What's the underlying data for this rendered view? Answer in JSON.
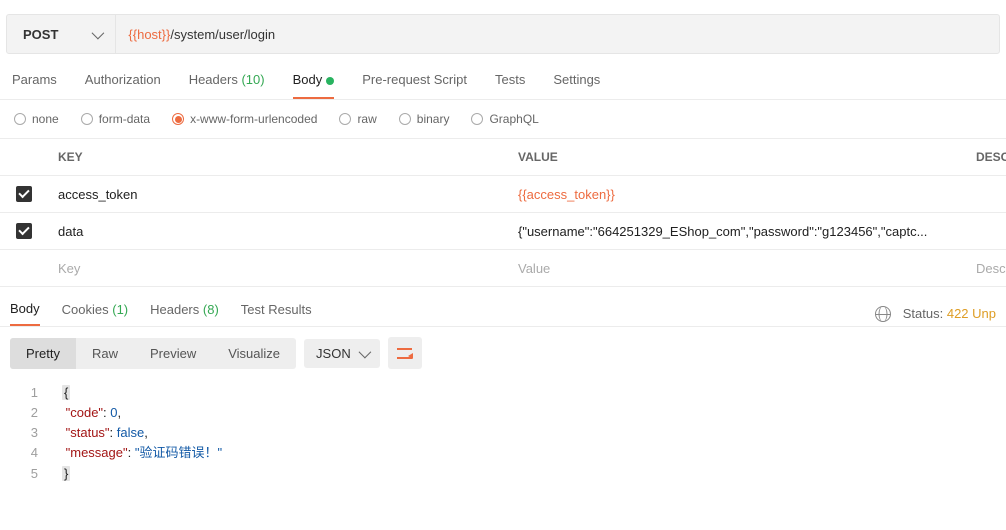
{
  "request": {
    "method": "POST",
    "url_var": "{{host}}",
    "url_path": "/system/user/login"
  },
  "tabs": {
    "params": "Params",
    "auth": "Authorization",
    "headers": "Headers",
    "headers_count": "(10)",
    "body": "Body",
    "prs": "Pre-request Script",
    "tests": "Tests",
    "settings": "Settings"
  },
  "body_types": {
    "none": "none",
    "form": "form-data",
    "xwww": "x-www-form-urlencoded",
    "raw": "raw",
    "binary": "binary",
    "graphql": "GraphQL"
  },
  "table": {
    "h_key": "KEY",
    "h_value": "VALUE",
    "h_desc": "DESC",
    "rows": [
      {
        "key": "access_token",
        "value": "{{access_token}}",
        "var": true
      },
      {
        "key": "data",
        "value": "{\"username\":\"664251329_EShop_com\",\"password\":\"g123456\",\"captc...",
        "var": false
      }
    ],
    "ph_key": "Key",
    "ph_value": "Value",
    "ph_desc": "Descr"
  },
  "resp_tabs": {
    "body": "Body",
    "cookies": "Cookies",
    "cookies_count": "(1)",
    "headers": "Headers",
    "headers_count": "(8)",
    "results": "Test Results",
    "status_label": "Status:",
    "status_value": "422 Unp"
  },
  "view": {
    "pretty": "Pretty",
    "raw": "Raw",
    "preview": "Preview",
    "visualize": "Visualize",
    "fmt": "JSON"
  },
  "response_json": {
    "code": 0,
    "status": false,
    "message": "验证码错误！"
  }
}
